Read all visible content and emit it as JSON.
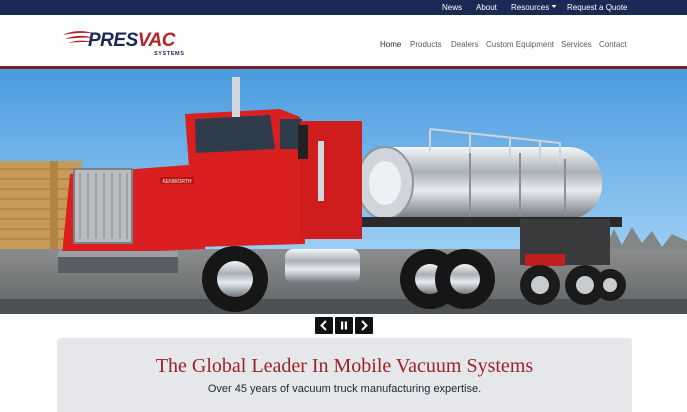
{
  "topbar": {
    "links": [
      "News",
      "About",
      "Resources",
      "Request a Quote"
    ]
  },
  "brand": {
    "word_part1": "PRES",
    "word_part2": "VAC",
    "subtitle": "SYSTEMS"
  },
  "nav": {
    "items": [
      "Home",
      "Products",
      "Dealers",
      "Custom Equipment",
      "Services",
      "Contact"
    ],
    "active": "Home"
  },
  "hero": {
    "truck_badge": "KENWORTH",
    "controls": [
      "previous",
      "pause",
      "next"
    ]
  },
  "tagline": {
    "title": "The Global Leader In Mobile Vacuum Systems",
    "subtitle": "Over 45 years of vacuum truck manufacturing expertise."
  },
  "colors": {
    "topbar": "#1b2a55",
    "accent_red": "#b3242b",
    "rule": "#7b1e24",
    "truck_red": "#d91f1f",
    "band": "#e6e7ea"
  },
  "icons": [
    "chevron-down-icon",
    "swoosh-logo-icon",
    "chevron-left-icon",
    "pause-icon",
    "chevron-right-icon"
  ]
}
